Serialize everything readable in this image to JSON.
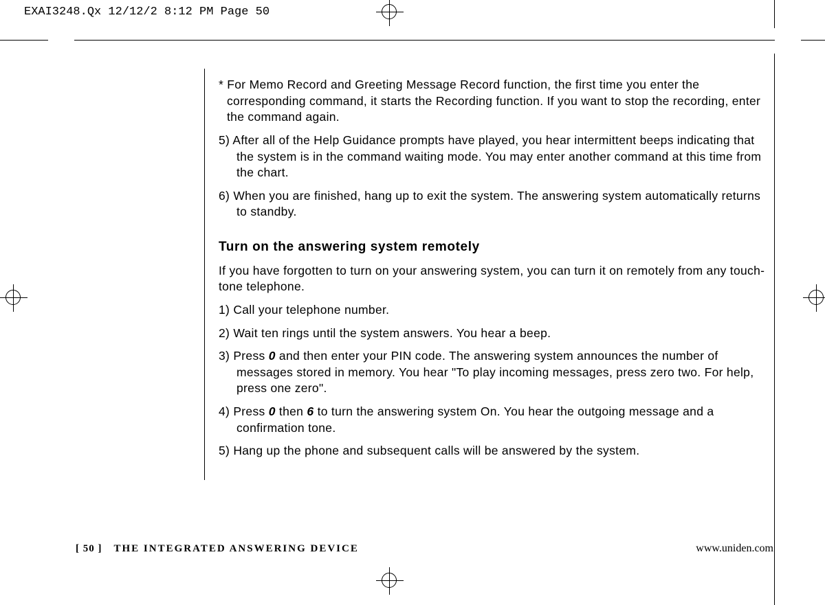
{
  "meta": {
    "jobline": "EXAI3248.Qx  12/12/2 8:12 PM  Page 50"
  },
  "body": {
    "note": "* For Memo Record and Greeting Message Record function, the first time you enter the corresponding command, it starts the Recording function. If you want to stop the recording, enter the command again.",
    "li5": "5) After all of the Help Guidance prompts have played, you hear intermittent beeps indicating that the system is in the command waiting mode. You may enter another command at this time from the chart.",
    "li6": "6) When you are finished, hang up to exit the system. The answering system automatically returns to standby.",
    "heading": "Turn on the answering system remotely",
    "intro": "If you have forgotten to turn on your answering system, you can turn it on remotely from any touch-tone telephone.",
    "r1": "1) Call your telephone number.",
    "r2": "2) Wait ten rings until the system answers. You hear a beep.",
    "r3a": "3) Press ",
    "r3_key0": "0",
    "r3b": " and then enter your PIN code. The answering system announces the number of messages stored in memory. You hear \"To play incoming messages, press zero two. For help, press one zero\".",
    "r4a": "4) Press ",
    "r4_key0": "0",
    "r4b": " then ",
    "r4_key6": "6",
    "r4c": " to turn the answering system On. You hear the outgoing message and a confirmation tone.",
    "r5": "5) Hang up the phone and subsequent calls will be answered by the system."
  },
  "footer": {
    "page": "[ 50 ]",
    "section": "THE INTEGRATED ANSWERING DEVICE",
    "url": "www.uniden.com"
  }
}
